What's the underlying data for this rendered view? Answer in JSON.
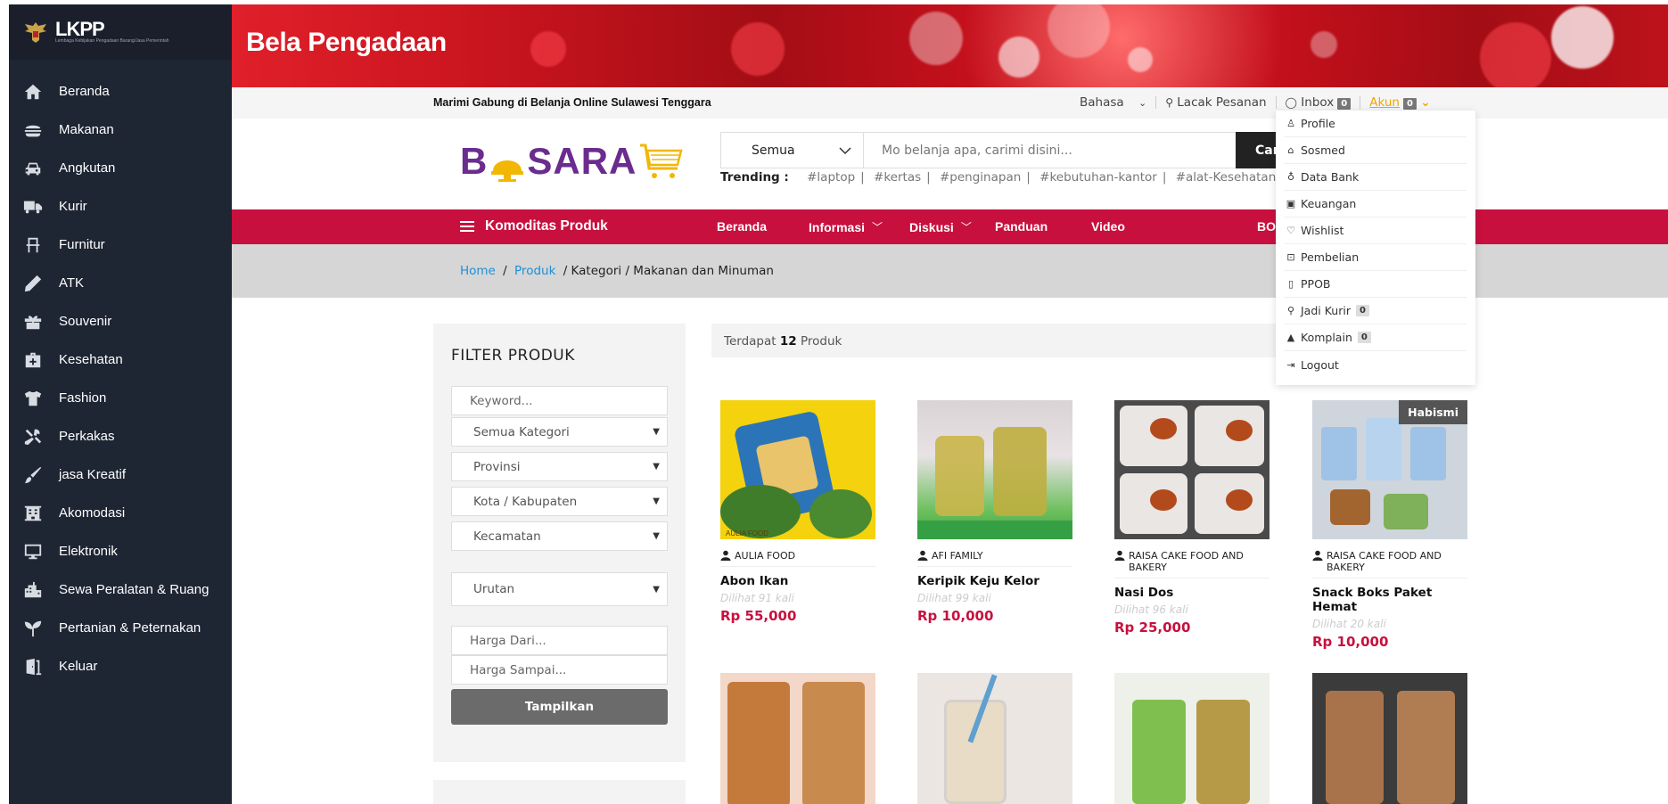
{
  "sidebar": {
    "brand_lk": "LK",
    "brand_pp": "PP",
    "brand_tagline": "Lembaga Kebijakan Pengadaan Barang/Jasa Pemerintah",
    "items": [
      {
        "label": "Beranda",
        "icon": "home-icon"
      },
      {
        "label": "Makanan",
        "icon": "burger-icon"
      },
      {
        "label": "Angkutan",
        "icon": "car-icon"
      },
      {
        "label": "Kurir",
        "icon": "truck-icon"
      },
      {
        "label": "Furnitur",
        "icon": "chair-icon"
      },
      {
        "label": "ATK",
        "icon": "pencil-icon"
      },
      {
        "label": "Souvenir",
        "icon": "gift-icon"
      },
      {
        "label": "Kesehatan",
        "icon": "medkit-icon"
      },
      {
        "label": "Fashion",
        "icon": "tshirt-icon"
      },
      {
        "label": "Perkakas",
        "icon": "tools-icon"
      },
      {
        "label": "jasa Kreatif",
        "icon": "brush-icon"
      },
      {
        "label": "Akomodasi",
        "icon": "building-icon"
      },
      {
        "label": "Elektronik",
        "icon": "monitor-icon"
      },
      {
        "label": "Sewa Peralatan & Ruang",
        "icon": "city-icon"
      },
      {
        "label": "Pertanian & Peternakan",
        "icon": "seedling-icon"
      },
      {
        "label": "Keluar",
        "icon": "door-exit-icon"
      }
    ]
  },
  "banner": {
    "title": "Bela Pengadaan"
  },
  "topbar": {
    "tagline": "Marimi Gabung di Belanja Online Sulawesi Tenggara",
    "language": "Bahasa",
    "track": "Lacak Pesanan",
    "inbox": "Inbox",
    "inbox_count": "0",
    "account": "Akun",
    "account_count": "0"
  },
  "header": {
    "logo_left": "B",
    "logo_right": "SARA",
    "category": "Semua",
    "search_placeholder": "Mo belanja apa, carimi disini...",
    "search_button": "Cari",
    "trending_label": "Trending :",
    "trending": [
      "#laptop",
      "#kertas",
      "#penginapan",
      "#kebutuhan-kantor",
      "#alat-Kesehatan"
    ],
    "trending_sep": "|"
  },
  "nav": {
    "komoditas": "Komoditas Produk",
    "beranda": "Beranda",
    "informasi": "Informasi",
    "diskusi": "Diskusi",
    "panduan": "Panduan",
    "video": "Video",
    "bos": "BOS"
  },
  "breadcrumb": {
    "home": "Home",
    "produk": "Produk",
    "rest": "/ Kategori / Makanan dan Minuman",
    "sep": "/"
  },
  "filter": {
    "title": "FILTER PRODUK",
    "keyword_placeholder": "Keyword...",
    "kategori": "Semua Kategori",
    "provinsi": "Provinsi",
    "kota": "Kota / Kabupaten",
    "kecamatan": "Kecamatan",
    "urutan": "Urutan",
    "harga_dari": "Harga Dari...",
    "harga_sampai": "Harga Sampai...",
    "button": "Tampilkan"
  },
  "results": {
    "prefix": "Terdapat",
    "count": "12",
    "suffix": "Produk"
  },
  "products": [
    {
      "seller": "AULIA FOOD",
      "name": "Abon Ikan",
      "views": "Dilihat 91 kali",
      "price": "Rp 55,000",
      "img_label": "AULIA FOOD"
    },
    {
      "seller": "AFI FAMILY",
      "name": "Keripik Keju Kelor",
      "views": "Dilihat 99 kali",
      "price": "Rp 10,000"
    },
    {
      "seller": "RAISA CAKE FOOD AND BAKERY",
      "name": "Nasi Dos",
      "views": "Dilihat 96 kali",
      "price": "Rp 25,000"
    },
    {
      "seller": "RAISA CAKE FOOD AND BAKERY",
      "name": "Snack Boks Paket Hemat",
      "views": "Dilihat 20 kali",
      "price": "Rp 10,000",
      "badge": "Habismi"
    }
  ],
  "dropdown": {
    "items": [
      {
        "label": "Profile",
        "icon": "user-outline-icon",
        "glyph": "♙"
      },
      {
        "label": "Sosmed",
        "icon": "store-icon",
        "glyph": "⌂"
      },
      {
        "label": "Data Bank",
        "icon": "moneybag-icon",
        "glyph": "♁"
      },
      {
        "label": "Keuangan",
        "icon": "money-bill-icon",
        "glyph": "▣"
      },
      {
        "label": "Wishlist",
        "icon": "heart-icon",
        "glyph": "♡"
      },
      {
        "label": "Pembelian",
        "icon": "shopping-bag-icon",
        "glyph": "⊡"
      },
      {
        "label": "PPOB",
        "icon": "mobile-icon",
        "glyph": "▯"
      },
      {
        "label": "Jadi Kurir",
        "icon": "motorcycle-icon",
        "glyph": "⚲",
        "count": "0"
      },
      {
        "label": "Komplain",
        "icon": "warning-icon",
        "glyph": "▲",
        "count": "0"
      },
      {
        "label": "Logout",
        "icon": "logout-icon",
        "glyph": "⇥"
      }
    ]
  },
  "colors": {
    "sidebar": "#1e2533",
    "nav": "#c8103e",
    "price": "#c8103e",
    "link": "#1e8fd6",
    "account": "#f0a500"
  }
}
